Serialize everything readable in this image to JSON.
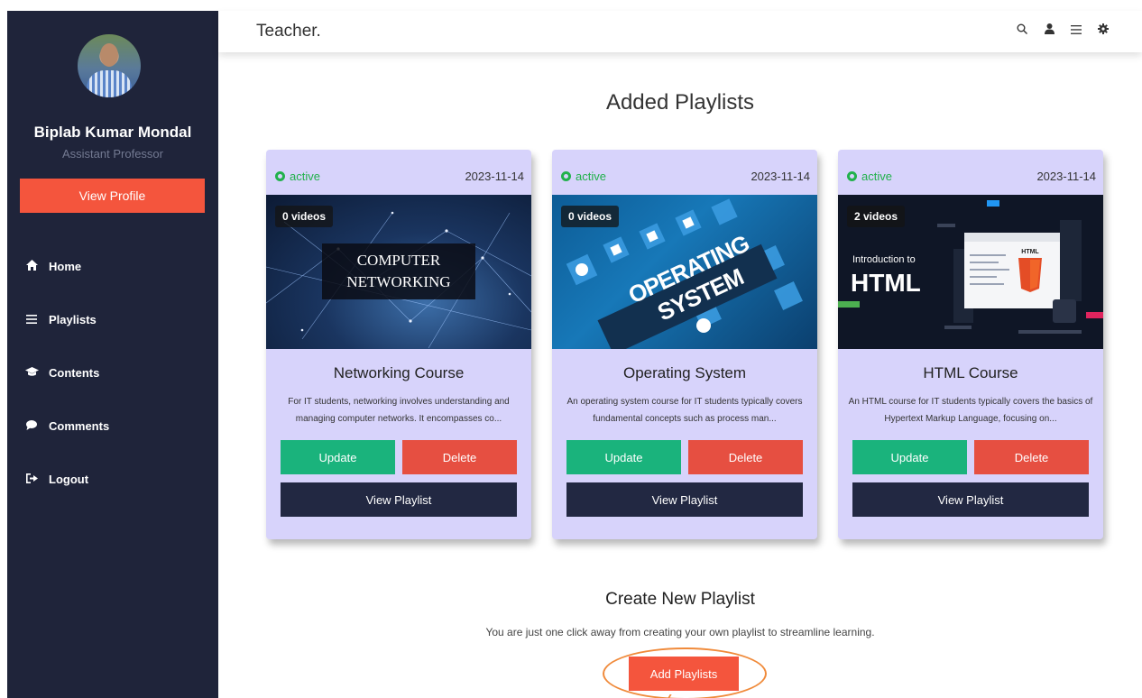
{
  "header": {
    "brand": "Teacher.",
    "icons": [
      "search-icon",
      "user-icon",
      "menu-icon",
      "gear-icon"
    ]
  },
  "sidebar": {
    "user_name": "Biplab Kumar Mondal",
    "user_role": "Assistant Professor",
    "view_profile_label": "View Profile",
    "items": [
      {
        "label": "Home",
        "icon": "home-icon"
      },
      {
        "label": "Playlists",
        "icon": "list-icon"
      },
      {
        "label": "Contents",
        "icon": "graduation-cap-icon"
      },
      {
        "label": "Comments",
        "icon": "comment-icon"
      },
      {
        "label": "Logout",
        "icon": "logout-icon"
      }
    ]
  },
  "main": {
    "title": "Added Playlists",
    "playlists": [
      {
        "status": "active",
        "date": "2023-11-14",
        "videos": "0 videos",
        "thumb_text": [
          "COMPUTER",
          "NETWORKING"
        ],
        "title": "Networking Course",
        "description": "For IT students, networking involves understanding and managing computer networks. It encompasses co...",
        "update_label": "Update",
        "delete_label": "Delete",
        "view_label": "View Playlist"
      },
      {
        "status": "active",
        "date": "2023-11-14",
        "videos": "0 videos",
        "thumb_text": [
          "OPERATING SYSTEM"
        ],
        "title": "Operating System",
        "description": "An operating system course for IT students typically covers fundamental concepts such as process man...",
        "update_label": "Update",
        "delete_label": "Delete",
        "view_label": "View Playlist"
      },
      {
        "status": "active",
        "date": "2023-11-14",
        "videos": "2 videos",
        "thumb_text": [
          "Introduction to",
          "HTML",
          "HTML"
        ],
        "title": "HTML Course",
        "description": "An HTML course for IT students typically covers the basics of Hypertext Markup Language, focusing on...",
        "update_label": "Update",
        "delete_label": "Delete",
        "view_label": "View Playlist"
      }
    ],
    "create": {
      "title": "Create New Playlist",
      "description": "You are just one click away from creating your own playlist to streamline learning.",
      "button_label": "Add Playlists"
    }
  },
  "colors": {
    "sidebar_bg": "#1f243a",
    "accent": "#f4553d",
    "update": "#1ab37c",
    "delete": "#e64f41",
    "view": "#222842",
    "card_bg": "#d7d3fb",
    "active": "#22b14c"
  }
}
